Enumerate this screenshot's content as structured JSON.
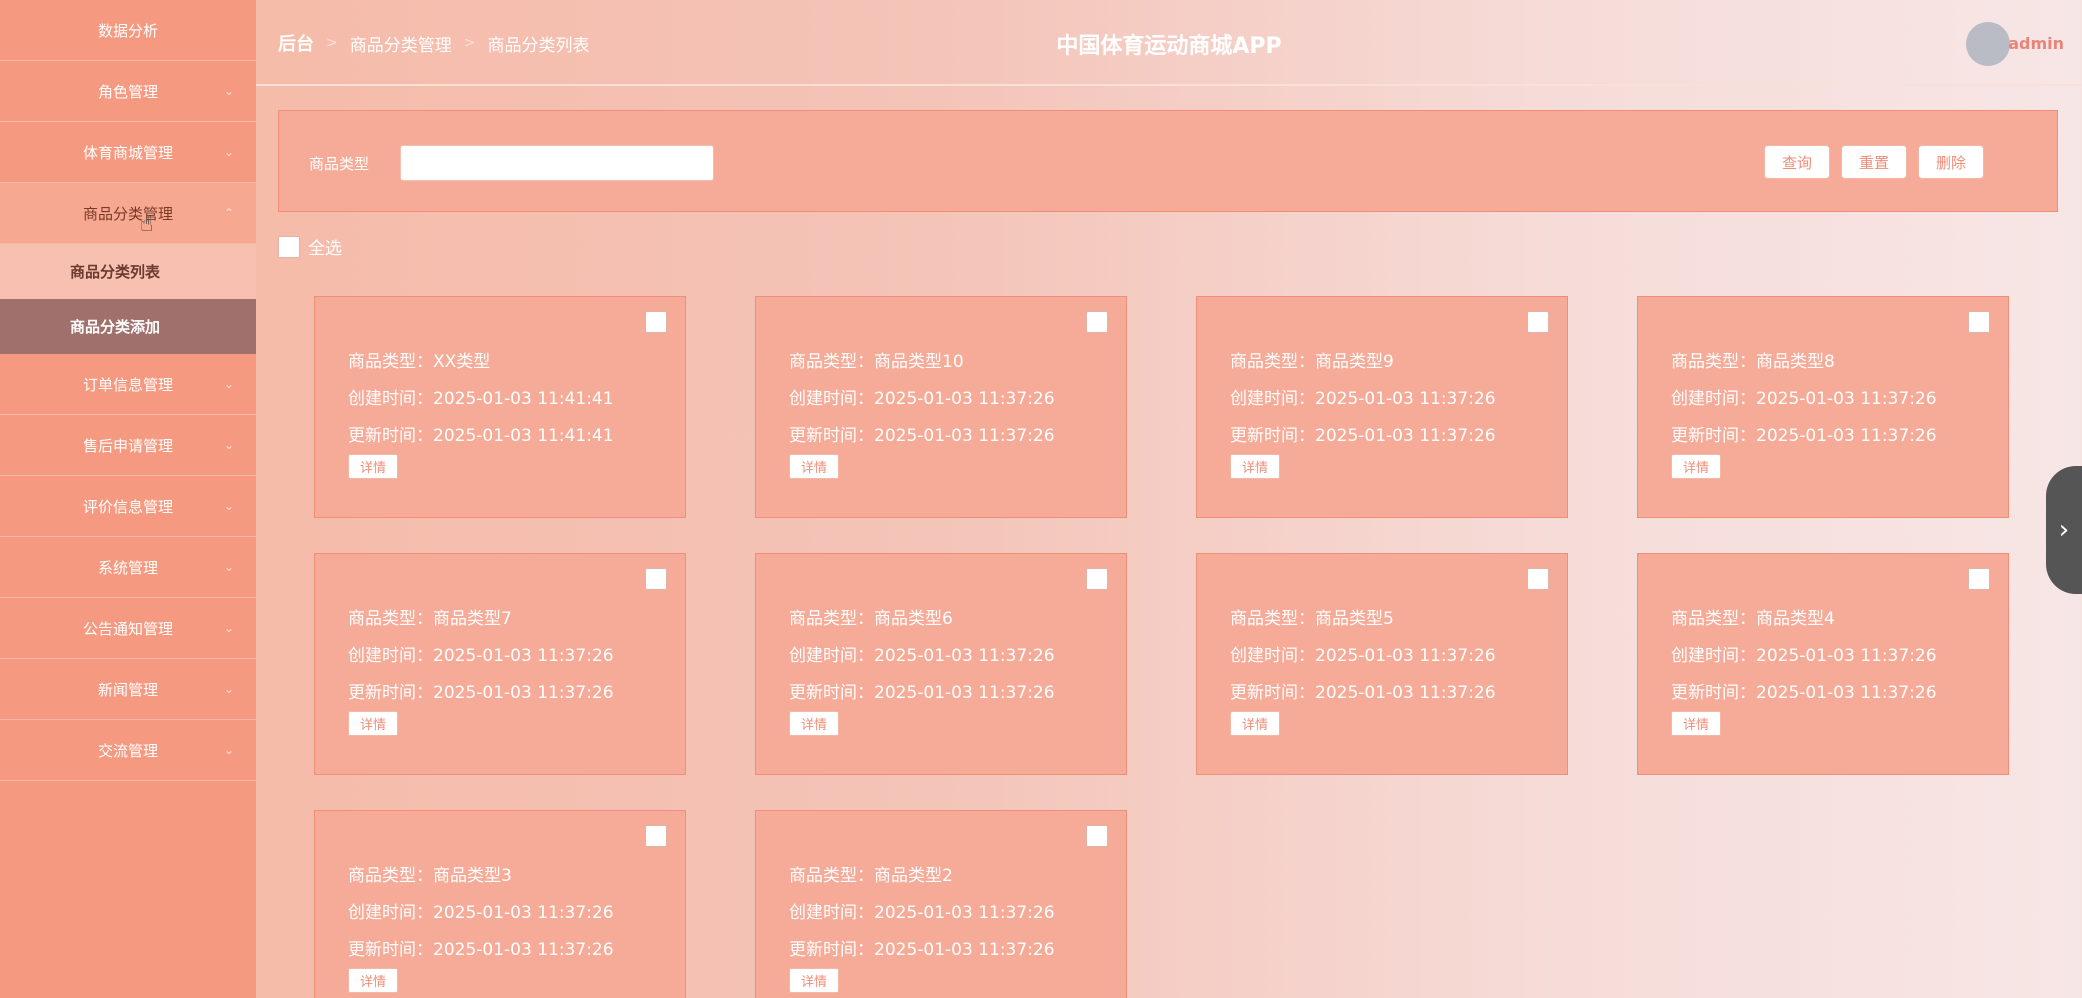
{
  "sidebar": {
    "items": [
      {
        "label": "数据分析",
        "chev": ""
      },
      {
        "label": "角色管理",
        "chev": "⌄"
      },
      {
        "label": "体育商城管理",
        "chev": "⌄"
      },
      {
        "label": "商品分类管理",
        "chev": "⌃"
      },
      {
        "label": "订单信息管理",
        "chev": "⌄"
      },
      {
        "label": "售后申请管理",
        "chev": "⌄"
      },
      {
        "label": "评价信息管理",
        "chev": "⌄"
      },
      {
        "label": "系统管理",
        "chev": "⌄"
      },
      {
        "label": "公告通知管理",
        "chev": "⌄"
      },
      {
        "label": "新闻管理",
        "chev": "⌄"
      },
      {
        "label": "交流管理",
        "chev": "⌄"
      }
    ],
    "subitems": [
      {
        "label": "商品分类列表"
      },
      {
        "label": "商品分类添加"
      }
    ]
  },
  "header": {
    "breadcrumb": [
      "后台",
      "商品分类管理",
      "商品分类列表"
    ],
    "title": "中国体育运动商城APP",
    "user": "admin"
  },
  "search": {
    "label": "商品类型",
    "value": "",
    "buttons": {
      "query": "查询",
      "reset": "重置",
      "delete": "删除"
    }
  },
  "select_all": "全选",
  "card_labels": {
    "type": "商品类型：",
    "created": "创建时间：",
    "updated": "更新时间：",
    "detail": "详情"
  },
  "cards": [
    {
      "type": "XX类型",
      "created": "2025-01-03 11:41:41",
      "updated": "2025-01-03 11:41:41"
    },
    {
      "type": "商品类型10",
      "created": "2025-01-03 11:37:26",
      "updated": "2025-01-03 11:37:26"
    },
    {
      "type": "商品类型9",
      "created": "2025-01-03 11:37:26",
      "updated": "2025-01-03 11:37:26"
    },
    {
      "type": "商品类型8",
      "created": "2025-01-03 11:37:26",
      "updated": "2025-01-03 11:37:26"
    },
    {
      "type": "商品类型7",
      "created": "2025-01-03 11:37:26",
      "updated": "2025-01-03 11:37:26"
    },
    {
      "type": "商品类型6",
      "created": "2025-01-03 11:37:26",
      "updated": "2025-01-03 11:37:26"
    },
    {
      "type": "商品类型5",
      "created": "2025-01-03 11:37:26",
      "updated": "2025-01-03 11:37:26"
    },
    {
      "type": "商品类型4",
      "created": "2025-01-03 11:37:26",
      "updated": "2025-01-03 11:37:26"
    },
    {
      "type": "商品类型3",
      "created": "2025-01-03 11:37:26",
      "updated": "2025-01-03 11:37:26"
    },
    {
      "type": "商品类型2",
      "created": "2025-01-03 11:37:26",
      "updated": "2025-01-03 11:37:26"
    }
  ],
  "side_tab_icon": "chevron-right-icon"
}
